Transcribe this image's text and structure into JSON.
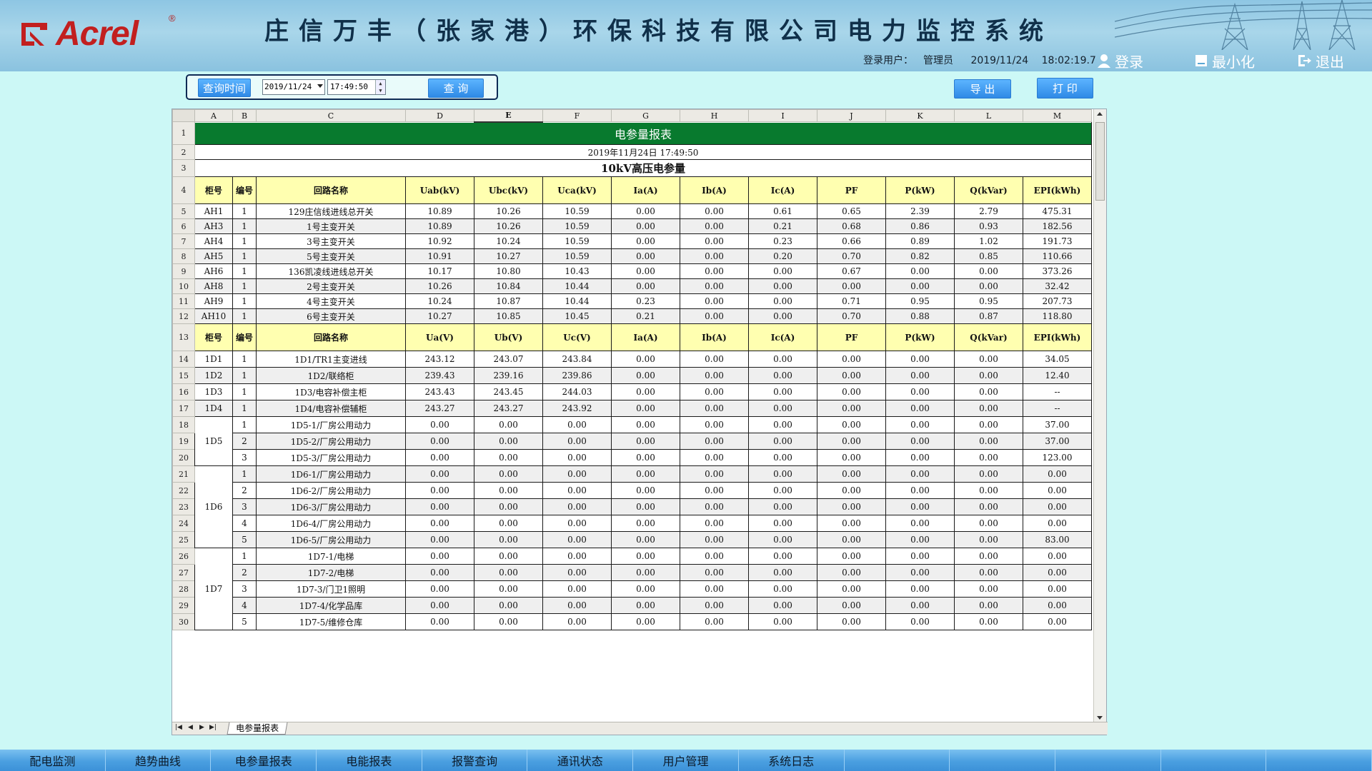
{
  "header": {
    "brand": "Acrel",
    "registered_mark": "®",
    "system_title": "庄信万丰（张家港）环保科技有限公司电力监控系统",
    "login_label": "登录用户：",
    "user": "管理员",
    "date": "2019/11/24",
    "time": "18:02:19.7",
    "login_button": "登录",
    "minimize_button": "最小化",
    "logout_button": "退出"
  },
  "query": {
    "time_button": "查询时间",
    "date_value": "2019/11/24",
    "time_value": "17:49:50",
    "search_button": "查 询"
  },
  "actions": {
    "export": "导 出",
    "print": "打 印"
  },
  "sheet": {
    "columns": [
      "A",
      "B",
      "C",
      "D",
      "E",
      "F",
      "G",
      "H",
      "I",
      "J",
      "K",
      "L",
      "M"
    ],
    "title": "电参量报表",
    "report_date": "2019年11月24日 17:49:50",
    "subtitle": "10kV高压电参量",
    "header_hv": [
      "柜号",
      "编号",
      "回路名称",
      "Uab(kV)",
      "Ubc(kV)",
      "Uca(kV)",
      "Ia(A)",
      "Ib(A)",
      "Ic(A)",
      "PF",
      "P(kW)",
      "Q(kVar)",
      "EPI(kWh)"
    ],
    "hv_rows": [
      {
        "cab": "AH1",
        "no": "1",
        "name": "129庄信线进线总开关",
        "v": [
          "10.89",
          "10.26",
          "10.59",
          "0.00",
          "0.00",
          "0.61",
          "0.65",
          "2.39",
          "2.79",
          "475.31"
        ]
      },
      {
        "cab": "AH3",
        "no": "1",
        "name": "1号主变开关",
        "v": [
          "10.89",
          "10.26",
          "10.59",
          "0.00",
          "0.00",
          "0.21",
          "0.68",
          "0.86",
          "0.93",
          "182.56"
        ]
      },
      {
        "cab": "AH4",
        "no": "1",
        "name": "3号主变开关",
        "v": [
          "10.92",
          "10.24",
          "10.59",
          "0.00",
          "0.00",
          "0.23",
          "0.66",
          "0.89",
          "1.02",
          "191.73"
        ]
      },
      {
        "cab": "AH5",
        "no": "1",
        "name": "5号主变开关",
        "v": [
          "10.91",
          "10.27",
          "10.59",
          "0.00",
          "0.00",
          "0.20",
          "0.70",
          "0.82",
          "0.85",
          "110.66"
        ]
      },
      {
        "cab": "AH6",
        "no": "1",
        "name": "136凯凌线进线总开关",
        "v": [
          "10.17",
          "10.80",
          "10.43",
          "0.00",
          "0.00",
          "0.00",
          "0.67",
          "0.00",
          "0.00",
          "373.26"
        ]
      },
      {
        "cab": "AH8",
        "no": "1",
        "name": "2号主变开关",
        "v": [
          "10.26",
          "10.84",
          "10.44",
          "0.00",
          "0.00",
          "0.00",
          "0.00",
          "0.00",
          "0.00",
          "32.42"
        ]
      },
      {
        "cab": "AH9",
        "no": "1",
        "name": "4号主变开关",
        "v": [
          "10.24",
          "10.87",
          "10.44",
          "0.23",
          "0.00",
          "0.00",
          "0.71",
          "0.95",
          "0.95",
          "207.73"
        ]
      },
      {
        "cab": "AH10",
        "no": "1",
        "name": "6号主变开关",
        "v": [
          "10.27",
          "10.85",
          "10.45",
          "0.21",
          "0.00",
          "0.00",
          "0.70",
          "0.88",
          "0.87",
          "118.80"
        ]
      }
    ],
    "header_lv": [
      "柜号",
      "编号",
      "回路名称",
      "Ua(V)",
      "Ub(V)",
      "Uc(V)",
      "Ia(A)",
      "Ib(A)",
      "Ic(A)",
      "PF",
      "P(kW)",
      "Q(kVar)",
      "EPI(kWh)"
    ],
    "lv_rows": [
      {
        "cab": "1D1",
        "no": "1",
        "name": "1D1/TR1主变进线",
        "v": [
          "243.12",
          "243.07",
          "243.84",
          "0.00",
          "0.00",
          "0.00",
          "0.00",
          "0.00",
          "0.00",
          "34.05"
        ]
      },
      {
        "cab": "1D2",
        "no": "1",
        "name": "1D2/联络柜",
        "v": [
          "239.43",
          "239.16",
          "239.86",
          "0.00",
          "0.00",
          "0.00",
          "0.00",
          "0.00",
          "0.00",
          "12.40"
        ]
      },
      {
        "cab": "1D3",
        "no": "1",
        "name": "1D3/电容补偿主柜",
        "v": [
          "243.43",
          "243.45",
          "244.03",
          "0.00",
          "0.00",
          "0.00",
          "0.00",
          "0.00",
          "0.00",
          "--"
        ]
      },
      {
        "cab": "1D4",
        "no": "1",
        "name": "1D4/电容补偿辅柜",
        "v": [
          "243.27",
          "243.27",
          "243.92",
          "0.00",
          "0.00",
          "0.00",
          "0.00",
          "0.00",
          "0.00",
          "--"
        ]
      },
      {
        "cab": "1D5",
        "no": "1",
        "name": "1D5-1/厂房公用动力",
        "v": [
          "0.00",
          "0.00",
          "0.00",
          "0.00",
          "0.00",
          "0.00",
          "0.00",
          "0.00",
          "0.00",
          "37.00"
        ]
      },
      {
        "cab": "",
        "no": "2",
        "name": "1D5-2/厂房公用动力",
        "v": [
          "0.00",
          "0.00",
          "0.00",
          "0.00",
          "0.00",
          "0.00",
          "0.00",
          "0.00",
          "0.00",
          "37.00"
        ]
      },
      {
        "cab": "",
        "no": "3",
        "name": "1D5-3/厂房公用动力",
        "v": [
          "0.00",
          "0.00",
          "0.00",
          "0.00",
          "0.00",
          "0.00",
          "0.00",
          "0.00",
          "0.00",
          "123.00"
        ]
      },
      {
        "cab": "1D6",
        "no": "1",
        "name": "1D6-1/厂房公用动力",
        "v": [
          "0.00",
          "0.00",
          "0.00",
          "0.00",
          "0.00",
          "0.00",
          "0.00",
          "0.00",
          "0.00",
          "0.00"
        ]
      },
      {
        "cab": "",
        "no": "2",
        "name": "1D6-2/厂房公用动力",
        "v": [
          "0.00",
          "0.00",
          "0.00",
          "0.00",
          "0.00",
          "0.00",
          "0.00",
          "0.00",
          "0.00",
          "0.00"
        ]
      },
      {
        "cab": "",
        "no": "3",
        "name": "1D6-3/厂房公用动力",
        "v": [
          "0.00",
          "0.00",
          "0.00",
          "0.00",
          "0.00",
          "0.00",
          "0.00",
          "0.00",
          "0.00",
          "0.00"
        ]
      },
      {
        "cab": "",
        "no": "4",
        "name": "1D6-4/厂房公用动力",
        "v": [
          "0.00",
          "0.00",
          "0.00",
          "0.00",
          "0.00",
          "0.00",
          "0.00",
          "0.00",
          "0.00",
          "0.00"
        ]
      },
      {
        "cab": "",
        "no": "5",
        "name": "1D6-5/厂房公用动力",
        "v": [
          "0.00",
          "0.00",
          "0.00",
          "0.00",
          "0.00",
          "0.00",
          "0.00",
          "0.00",
          "0.00",
          "83.00"
        ]
      },
      {
        "cab": "1D7",
        "no": "1",
        "name": "1D7-1/电梯",
        "v": [
          "0.00",
          "0.00",
          "0.00",
          "0.00",
          "0.00",
          "0.00",
          "0.00",
          "0.00",
          "0.00",
          "0.00"
        ]
      },
      {
        "cab": "",
        "no": "2",
        "name": "1D7-2/电梯",
        "v": [
          "0.00",
          "0.00",
          "0.00",
          "0.00",
          "0.00",
          "0.00",
          "0.00",
          "0.00",
          "0.00",
          "0.00"
        ]
      },
      {
        "cab": "",
        "no": "3",
        "name": "1D7-3/门卫1照明",
        "v": [
          "0.00",
          "0.00",
          "0.00",
          "0.00",
          "0.00",
          "0.00",
          "0.00",
          "0.00",
          "0.00",
          "0.00"
        ]
      },
      {
        "cab": "",
        "no": "4",
        "name": "1D7-4/化学品库",
        "v": [
          "0.00",
          "0.00",
          "0.00",
          "0.00",
          "0.00",
          "0.00",
          "0.00",
          "0.00",
          "0.00",
          "0.00"
        ]
      },
      {
        "cab": "",
        "no": "5",
        "name": "1D7-5/维修仓库",
        "v": [
          "0.00",
          "0.00",
          "0.00",
          "0.00",
          "0.00",
          "0.00",
          "0.00",
          "0.00",
          "0.00",
          "0.00"
        ]
      }
    ],
    "tab_name": "电参量报表"
  },
  "nav": [
    "配电监测",
    "趋势曲线",
    "电参量报表",
    "电能报表",
    "报警查询",
    "通讯状态",
    "用户管理",
    "系统日志",
    "",
    "",
    "",
    "",
    ""
  ],
  "colors": {
    "title_green": "#087a2e",
    "header_yellow": "#ffffb0",
    "nav_blue": "#4a9fe0",
    "bg": "#ccf8f6"
  }
}
